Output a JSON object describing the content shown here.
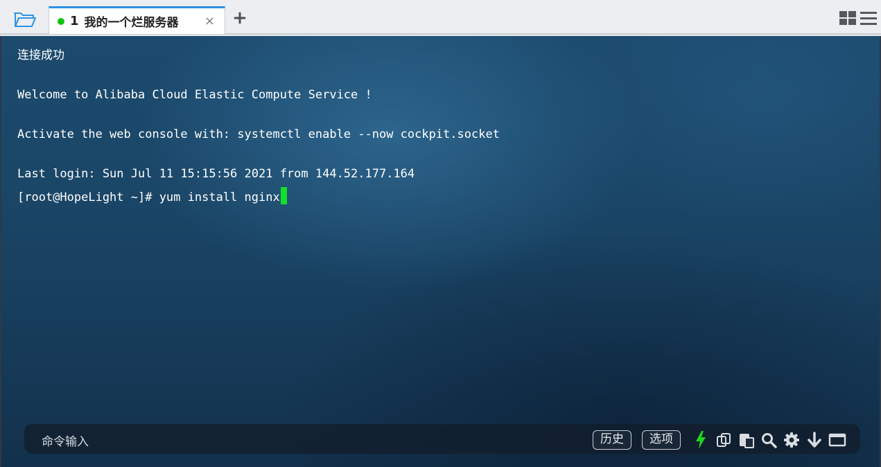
{
  "tab": {
    "number": "1",
    "title": "我的一个烂服务器",
    "close": "×",
    "status_color": "#13c40f"
  },
  "add_tab": "+",
  "terminal": {
    "lines": [
      "连接成功",
      "Welcome to Alibaba Cloud Elastic Compute Service !",
      "Activate the web console with: systemctl enable --now cockpit.socket",
      "Last login: Sun Jul 11 15:15:56 2021 from 144.52.177.164",
      "[root@HopeLight ~]# yum install nginx"
    ],
    "cursor_color": "#12e02a"
  },
  "command_bar": {
    "placeholder": "命令输入",
    "history_label": "历史",
    "options_label": "选项",
    "icons": [
      "lightning-icon",
      "copy-icon",
      "paste-icon",
      "search-icon",
      "gear-icon",
      "arrow-down-icon",
      "window-icon"
    ]
  },
  "colors": {
    "accent": "#2b93e6",
    "terminal_bg": "#1a4566"
  }
}
